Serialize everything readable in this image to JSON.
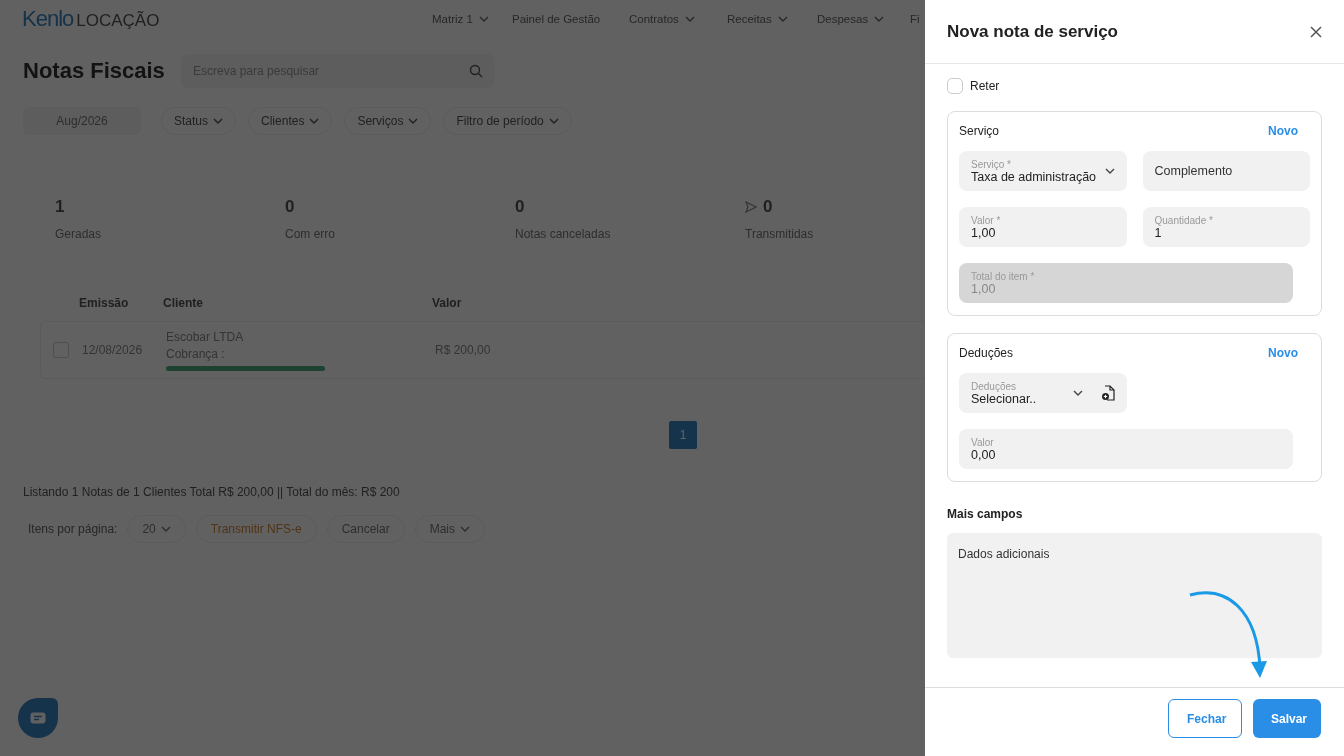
{
  "app": {
    "logo_brand": "Kenlo",
    "logo_product": "LOCAÇÃO"
  },
  "nav": [
    {
      "label": "Matriz 1",
      "dropdown": true
    },
    {
      "label": "Painel de Gestão",
      "dropdown": false
    },
    {
      "label": "Contratos",
      "dropdown": true
    },
    {
      "label": "Receitas",
      "dropdown": true
    },
    {
      "label": "Despesas",
      "dropdown": true
    },
    {
      "label": "Fi",
      "dropdown": false
    }
  ],
  "page": {
    "title": "Notas Fiscais",
    "search": {
      "placeholder": "Escreva para pesquisar"
    }
  },
  "filters": {
    "month": "Aug/2026",
    "chips": [
      "Status",
      "Clientes",
      "Serviços",
      "Filtro de período"
    ]
  },
  "stats": [
    {
      "value": "1",
      "label": "Geradas",
      "kind": "plain"
    },
    {
      "value": "0",
      "label": "Com erro",
      "kind": "plain"
    },
    {
      "value": "0",
      "label": "Notas canceladas",
      "kind": "plain"
    },
    {
      "value": "0",
      "label": "Transmitidas",
      "kind": "sent"
    }
  ],
  "table": {
    "columns": [
      "Emissão",
      "Cliente",
      "Valor"
    ],
    "rows": [
      {
        "checked": false,
        "date": "12/08/2026",
        "client": "Escobar LTDA",
        "billing": "Cobrança :",
        "level": 1,
        "amount": "R$ 200,00"
      }
    ]
  },
  "pagination": [
    {
      "label": "1",
      "selected": true
    }
  ],
  "summary": "Listando 1 Notas de 1 Clientes Total R$ 200,00 || Total do mês: R$ 200",
  "footer_controls": {
    "per_page_label": "Itens por página:",
    "per_page": "20",
    "buttons": [
      {
        "label": "Transmitir NFS-e",
        "kind": "accent"
      },
      {
        "label": "Cancelar",
        "kind": "plain"
      },
      {
        "label": "Mais",
        "kind": "menu"
      }
    ]
  },
  "drawer": {
    "title": "Nova nota de serviço",
    "reter": {
      "label": "Reter",
      "checked": false
    },
    "sections": [
      {
        "title": "Serviço",
        "action": "Novo",
        "fields": [
          {
            "kind": "select",
            "label": "Serviço *",
            "value": "Taxa de administração",
            "disabled": false
          },
          {
            "kind": "text",
            "placeholder": "Complemento",
            "disabled": false
          },
          {
            "kind": "text",
            "label": "Valor *",
            "value": "1,00",
            "disabled": false
          },
          {
            "kind": "text",
            "label": "Quantidade *",
            "value": "1",
            "disabled": false
          },
          {
            "kind": "wide",
            "label": "Total do item *",
            "value": "1,00",
            "disabled": true
          }
        ]
      },
      {
        "title": "Deduções",
        "action": "Novo",
        "fields": [
          {
            "kind": "select-add",
            "label": "Deduções",
            "value": "Selecionar..",
            "disabled": false
          },
          {
            "kind": "wide",
            "label": "Valor",
            "value": "0,00",
            "disabled": false
          }
        ]
      }
    ],
    "more_title": "Mais campos",
    "notes": {
      "placeholder": "Dados adicionais"
    },
    "buttons": [
      {
        "label": "Fechar",
        "kind": "secondary"
      },
      {
        "label": "Salvar",
        "kind": "primary"
      }
    ]
  }
}
